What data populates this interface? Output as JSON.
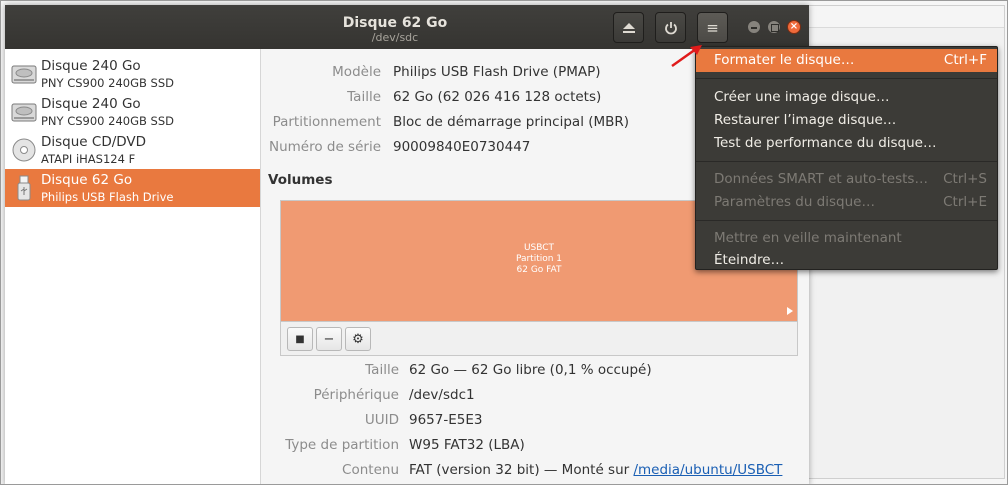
{
  "window": {
    "title": "Disque 62 Go",
    "subtitle": "/dev/sdc"
  },
  "toolbar": {
    "eject_icon": "eject-icon",
    "power_icon": "power-icon",
    "menu_icon": "hamburger-menu-icon",
    "menu_glyph": "≡",
    "close_glyph": "×"
  },
  "drives": [
    {
      "name": "Disque 240 Go",
      "model": "PNY CS900 240GB SSD",
      "icon": "hard-disk-icon"
    },
    {
      "name": "Disque 240 Go",
      "model": "PNY CS900 240GB SSD",
      "icon": "hard-disk-icon"
    },
    {
      "name": "Disque CD/DVD",
      "model": "ATAPI   iHAS124   F",
      "icon": "optical-disc-icon"
    },
    {
      "name": "Disque 62 Go",
      "model": "Philips USB Flash Drive",
      "icon": "usb-drive-icon",
      "selected": true
    }
  ],
  "disk": {
    "model_label": "Modèle",
    "model_value": "Philips USB Flash Drive (PMAP)",
    "size_label": "Taille",
    "size_value": "62 Go (62 026 416 128 octets)",
    "partitioning_label": "Partitionnement",
    "partitioning_value": "Bloc de démarrage principal (MBR)",
    "serial_label": "Numéro de série",
    "serial_value": "90009840E0730447"
  },
  "volumes": {
    "title": "Volumes",
    "partition": {
      "line1": "USBCT",
      "line2": "Partition 1",
      "line3": "62 Go FAT"
    },
    "tools": {
      "stop_icon": "stop-icon",
      "stop_glyph": "■",
      "remove_icon": "minus-icon",
      "remove_glyph": "−",
      "settings_icon": "gears-icon",
      "settings_glyph": "⚙"
    }
  },
  "volume_info": {
    "size_label": "Taille",
    "size_value": "62 Go — 62 Go libre (0,1 % occupé)",
    "device_label": "Périphérique",
    "device_value": "/dev/sdc1",
    "uuid_label": "UUID",
    "uuid_value": "9657-E5E3",
    "type_label": "Type de partition",
    "type_value": "W95 FAT32 (LBA)",
    "content_label": "Contenu",
    "content_value": "FAT (version 32 bit) — Monté sur ",
    "content_link": "/media/ubuntu/USBCT"
  },
  "menu": {
    "items": [
      {
        "label": "Formater le disque…",
        "shortcut": "Ctrl+F",
        "state": "highlighted"
      },
      {
        "label": "Créer une image disque…",
        "shortcut": "",
        "state": "enabled"
      },
      {
        "label": "Restaurer l’image disque…",
        "shortcut": "",
        "state": "enabled"
      },
      {
        "label": "Test de performance du disque…",
        "shortcut": "",
        "state": "enabled"
      },
      {
        "label": "Données SMART et auto-tests…",
        "shortcut": "Ctrl+S",
        "state": "disabled"
      },
      {
        "label": "Paramètres du disque…",
        "shortcut": "Ctrl+E",
        "state": "disabled"
      },
      {
        "label": "Mettre en veille maintenant",
        "shortcut": "",
        "state": "disabled"
      },
      {
        "label": "Éteindre…",
        "shortcut": "",
        "state": "enabled"
      }
    ]
  },
  "colors": {
    "accent": "#e9793f",
    "titlebar": "#3c3b37",
    "partition": "#f09a72",
    "arrow": "#e01b1b"
  }
}
